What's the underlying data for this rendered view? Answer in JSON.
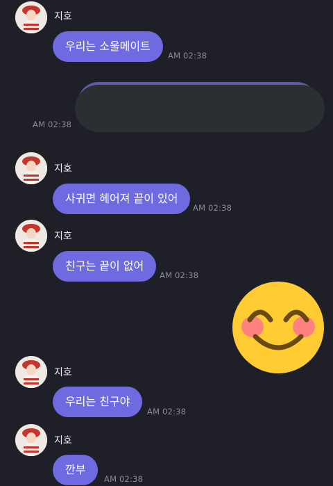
{
  "sender_name": "지호",
  "messages": [
    {
      "type": "received",
      "name": "지호",
      "text": "우리는 소울메이트",
      "time": "AM 02:38"
    },
    {
      "type": "sent",
      "text": "",
      "time": "AM 02:38"
    },
    {
      "type": "received",
      "name": "지호",
      "text": "사귀면 헤어져 끝이 있어",
      "time": "AM 02:38"
    },
    {
      "type": "received",
      "name": "지호",
      "text": "친구는 끝이 없어",
      "time": "AM 02:38"
    },
    {
      "type": "sticker",
      "icon": "smiling-face-emoji"
    },
    {
      "type": "received",
      "name": "지호",
      "text": "우리는 친구야",
      "time": "AM 02:38"
    },
    {
      "type": "received",
      "name": "지호",
      "text": "깐부",
      "time": "AM 02:38"
    }
  ],
  "colors": {
    "background": "#1f1f27",
    "bubble_received": "#6f6ae0",
    "timestamp": "#8c8c99",
    "emoji_face": "#ffcc33",
    "emoji_cheeks": "#ff7a8a"
  }
}
